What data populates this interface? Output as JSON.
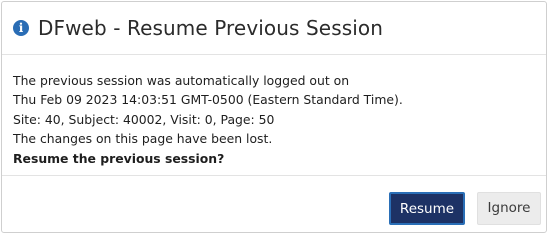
{
  "dialog": {
    "icon": "info-icon",
    "title": "DFweb - Resume Previous Session",
    "message_lines": [
      "The previous session was automatically logged out on",
      "Thu Feb 09 2023 14:03:51 GMT-0500 (Eastern Standard Time).",
      "Site: 40, Subject: 40002, Visit: 0, Page: 50",
      "The changes on this page have been lost."
    ],
    "question": "Resume the previous session?",
    "resume_label": "Resume",
    "ignore_label": "Ignore"
  },
  "colors": {
    "primary_button": "#1d3265",
    "primary_button_border": "#2a6fb7",
    "info_icon": "#2a6db5",
    "secondary_button": "#ececec"
  }
}
